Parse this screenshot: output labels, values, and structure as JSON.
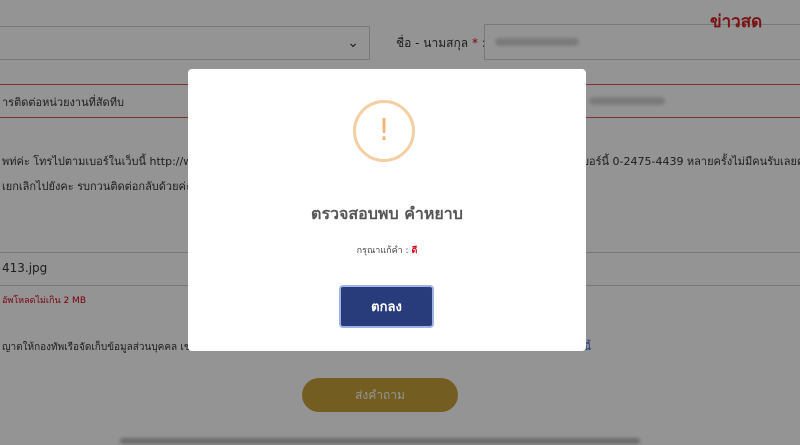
{
  "watermark": "ข่าวสด",
  "form": {
    "name_label": "ชื่อ - นามสกุล",
    "required_mark": "*",
    "name_label_colon": " :",
    "agency_text": "ารติดต่อหน่วยงานที่สัดทีบ",
    "body_line1": "พท่ค่ะ โทรไปตามเบอร์ในเว็บนี้ http://www",
    "body_line1_right": "บอร์นี้ 0-2475-4439 หลายครั้งไม่มีคนรับเลยค",
    "body_line2": "เยกเลิกไปยังคะ รบกวนติดต่อกลับด้วยค่ะ",
    "file_name": "413.jpg",
    "file_hint": "อัพโหลดไม่เกิน 2 MB",
    "consent_text": "ญาตให้กองทัพเรือจัดเก็บข้อมูลส่วนบุคคล เช",
    "consent_link": "นี้",
    "submit_label": "ส่งคำถาม"
  },
  "modal": {
    "icon": "exclamation-icon",
    "icon_glyph": "!",
    "title": "ตรวจสอบพบ คำหยาบ",
    "message": "กรุณาแก้คำ :",
    "flagged_word": "ดี",
    "ok_label": "ตกลง"
  },
  "colors": {
    "overlay": "#000000",
    "ok_button": "#283c7c",
    "submit_button": "#c7a13a",
    "warning_icon": "#f5cfa2",
    "watermark": "#d32222"
  }
}
